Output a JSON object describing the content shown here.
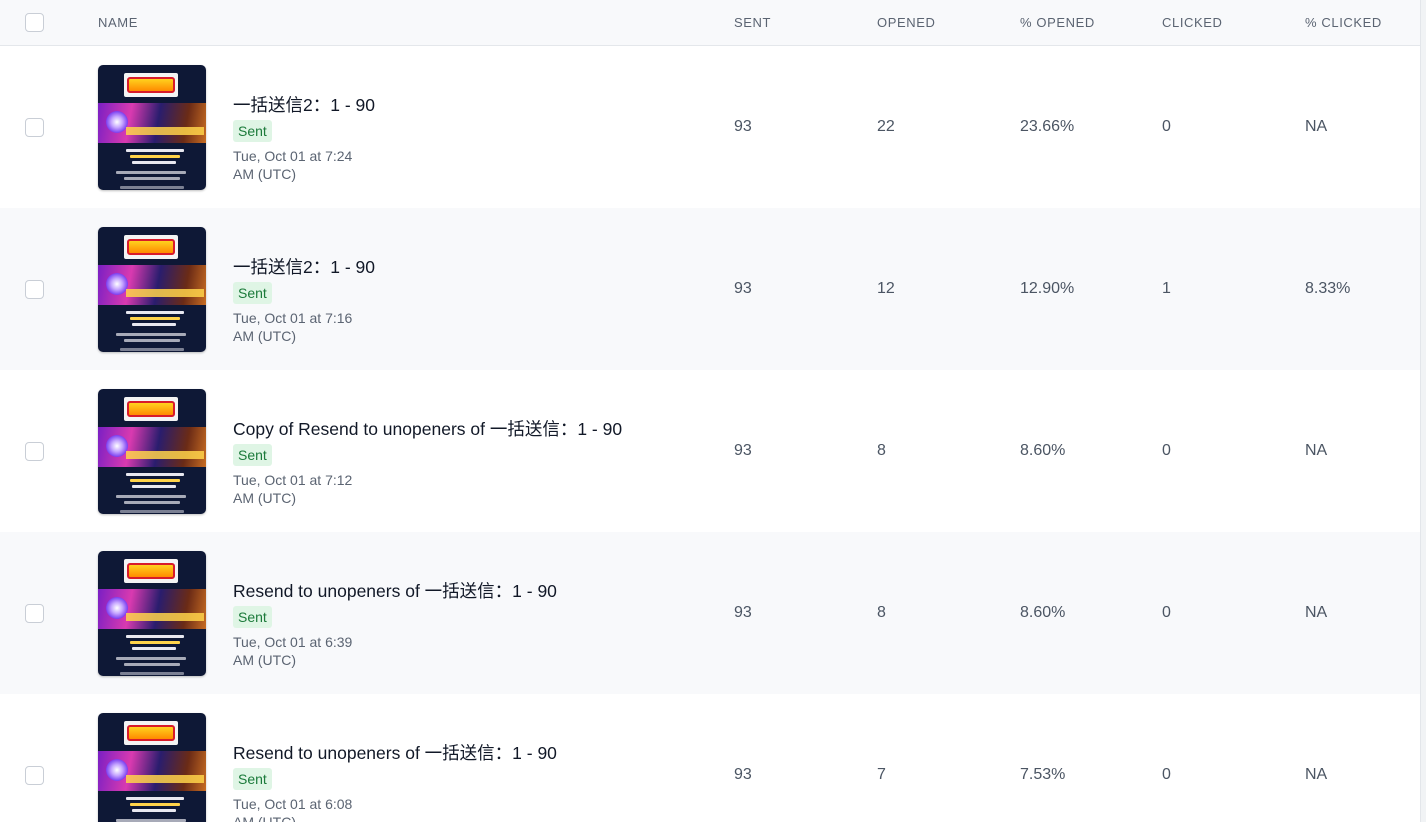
{
  "header": {
    "name": "NAME",
    "sent": "SENT",
    "opened": "OPENED",
    "pct_opened": "% OPENED",
    "clicked": "CLICKED",
    "pct_clicked": "% CLICKED"
  },
  "rows": [
    {
      "title": "一括送信2：1 - 90",
      "status": "Sent",
      "date_line1": "Tue, Oct 01 at 7:24",
      "date_line2": "AM (UTC)",
      "sent": "93",
      "opened": "22",
      "pct_opened": "23.66%",
      "clicked": "0",
      "pct_clicked": "NA"
    },
    {
      "title": "一括送信2：1 - 90",
      "status": "Sent",
      "date_line1": "Tue, Oct 01 at 7:16",
      "date_line2": "AM (UTC)",
      "sent": "93",
      "opened": "12",
      "pct_opened": "12.90%",
      "clicked": "1",
      "pct_clicked": "8.33%"
    },
    {
      "title": "Copy of Resend to unopeners of 一括送信：1 - 90",
      "status": "Sent",
      "date_line1": "Tue, Oct 01 at 7:12",
      "date_line2": "AM (UTC)",
      "sent": "93",
      "opened": "8",
      "pct_opened": "8.60%",
      "clicked": "0",
      "pct_clicked": "NA"
    },
    {
      "title": "Resend to unopeners of 一括送信：1 - 90",
      "status": "Sent",
      "date_line1": "Tue, Oct 01 at 6:39",
      "date_line2": "AM (UTC)",
      "sent": "93",
      "opened": "8",
      "pct_opened": "8.60%",
      "clicked": "0",
      "pct_clicked": "NA"
    },
    {
      "title": "Resend to unopeners of 一括送信：1 - 90",
      "status": "Sent",
      "date_line1": "Tue, Oct 01 at 6:08",
      "date_line2": "AM (UTC)",
      "sent": "93",
      "opened": "7",
      "pct_opened": "7.53%",
      "clicked": "0",
      "pct_clicked": "NA"
    }
  ],
  "colors": {
    "status_text": "#1b7a3a",
    "status_bg": "#dff5e5",
    "row_alt_bg": "#f8f9fb"
  }
}
